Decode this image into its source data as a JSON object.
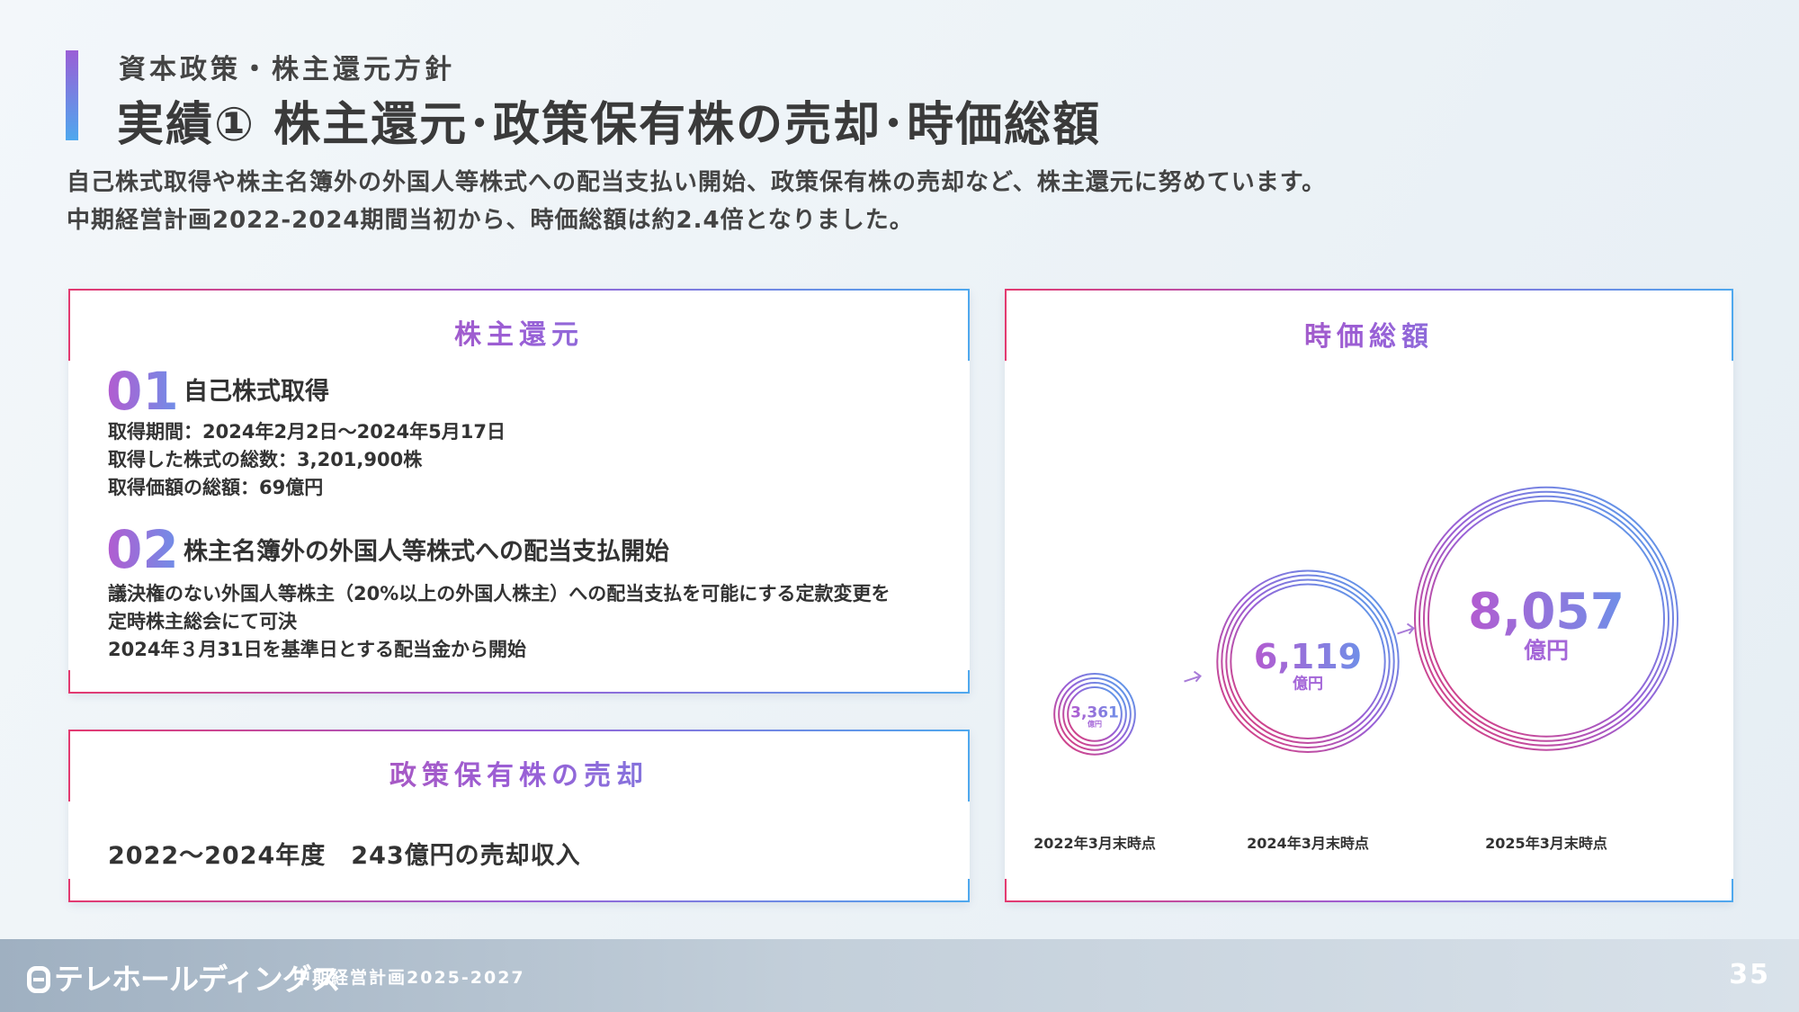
{
  "header": {
    "section": "資本政策・株主還元方針",
    "title": "実績① 株主還元･政策保有株の売却･時価総額",
    "lead_1": "自己株式取得や株主名簿外の外国人等株式への配当支払い開始、政策保有株の売却など、株主還元に努めています。",
    "lead_2": "中期経営計画2022-2024期間当初から、時価総額は約2.4倍となりました。"
  },
  "shareholder_return": {
    "title": "株主還元",
    "items": [
      {
        "num": "01",
        "heading": "自己株式取得",
        "lines": [
          "取得期間：2024年2月2日～2024年5月17日",
          "取得した株式の総数：3,201,900株",
          "取得価額の総額：69億円"
        ]
      },
      {
        "num": "02",
        "heading": "株主名簿外の外国人等株式への配当支払開始",
        "lines": [
          "議決権のない外国人等株主（20%以上の外国人株主）への配当支払を可能にする定款変更を",
          "定時株主総会にて可決",
          "2024年３月31日を基準日とする配当金から開始"
        ]
      }
    ]
  },
  "policy_shares": {
    "title": "政策保有株の売却",
    "text": "2022～2024年度　243億円の売却収入"
  },
  "market_cap": {
    "title": "時価総額",
    "unit": "億円"
  },
  "chart_data": {
    "type": "bubble",
    "title": "時価総額",
    "unit": "億円",
    "categories": [
      "2022年3月末時点",
      "2024年3月末時点",
      "2025年3月末時点"
    ],
    "values": [
      3361,
      6119,
      8057
    ],
    "labels": [
      "3,361",
      "6,119",
      "8,057"
    ]
  },
  "footer": {
    "logo": "テレホールディングス",
    "plan": "中期経営計画2025-2027",
    "page": "35"
  },
  "colors": {
    "accent_pink": "#e33a70",
    "accent_purple": "#9a5fd6",
    "accent_blue": "#4fa8ee"
  }
}
